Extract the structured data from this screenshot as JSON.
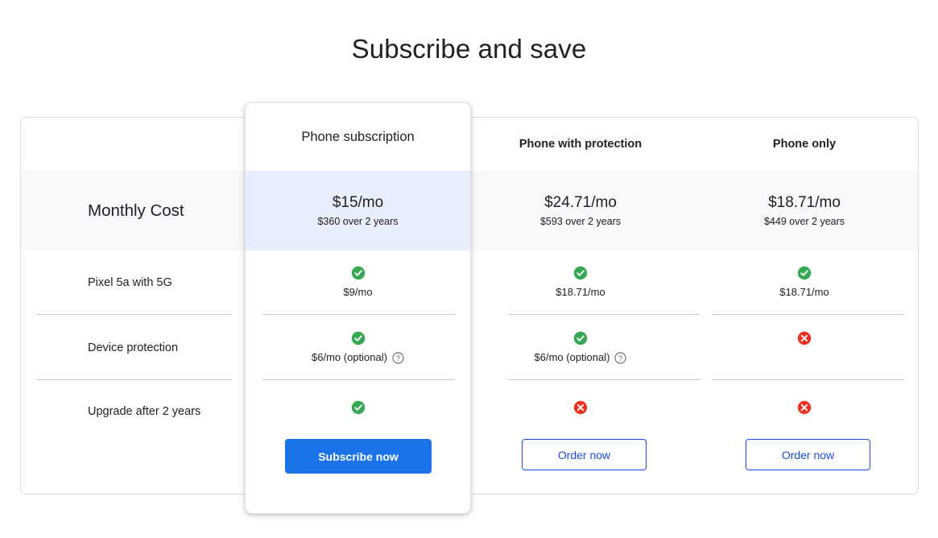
{
  "page": {
    "title": "Subscribe and save"
  },
  "colors": {
    "accent_blue": "#1a73e8",
    "outline_blue": "#1a4ae8",
    "check_green": "#34a853",
    "cross_red": "#ea3323",
    "band_grey": "#f7f9fa",
    "band_blue": "#e8eefb",
    "divider": "#c6c8cc",
    "card_border": "#dadce0"
  },
  "table": {
    "row_header_label": "Monthly Cost",
    "columns": [
      {
        "id": "phone-subscription",
        "header": "Phone subscription",
        "featured": true,
        "cost_main": "$15/mo",
        "cost_sub": "$360 over 2 years",
        "cta_label": "Subscribe now",
        "cta_style": "primary"
      },
      {
        "id": "phone-with-protection",
        "header": "Phone with protection",
        "featured": false,
        "cost_main": "$24.71/mo",
        "cost_sub": "$593 over 2 years",
        "cta_label": "Order now",
        "cta_style": "outline"
      },
      {
        "id": "phone-only",
        "header": "Phone only",
        "featured": false,
        "cost_main": "$18.71/mo",
        "cost_sub": "$449 over 2 years",
        "cta_label": "Order now",
        "cta_style": "outline"
      }
    ],
    "rows": [
      {
        "id": "pixel-5a-with-5g",
        "label": "Pixel 5a with 5G",
        "cells": [
          {
            "icon": "check-circle-icon",
            "note": "$9/mo",
            "help": false
          },
          {
            "icon": "check-circle-icon",
            "note": "$18.71/mo",
            "help": false
          },
          {
            "icon": "check-circle-icon",
            "note": "$18.71/mo",
            "help": false
          }
        ]
      },
      {
        "id": "device-protection",
        "label": "Device protection",
        "cells": [
          {
            "icon": "check-circle-icon",
            "note": "$6/mo (optional)",
            "help": true
          },
          {
            "icon": "check-circle-icon",
            "note": "$6/mo (optional)",
            "help": true
          },
          {
            "icon": "cross-circle-icon",
            "note": "",
            "help": false
          }
        ]
      },
      {
        "id": "upgrade-after-2-years",
        "label": "Upgrade after 2 years",
        "cells": [
          {
            "icon": "check-circle-icon",
            "note": "",
            "help": false
          },
          {
            "icon": "cross-circle-icon",
            "note": "",
            "help": false
          },
          {
            "icon": "cross-circle-icon",
            "note": "",
            "help": false
          }
        ]
      }
    ]
  },
  "icons": {
    "check": "check-circle-icon",
    "cross": "cross-circle-icon",
    "help": "help-circle-icon"
  }
}
